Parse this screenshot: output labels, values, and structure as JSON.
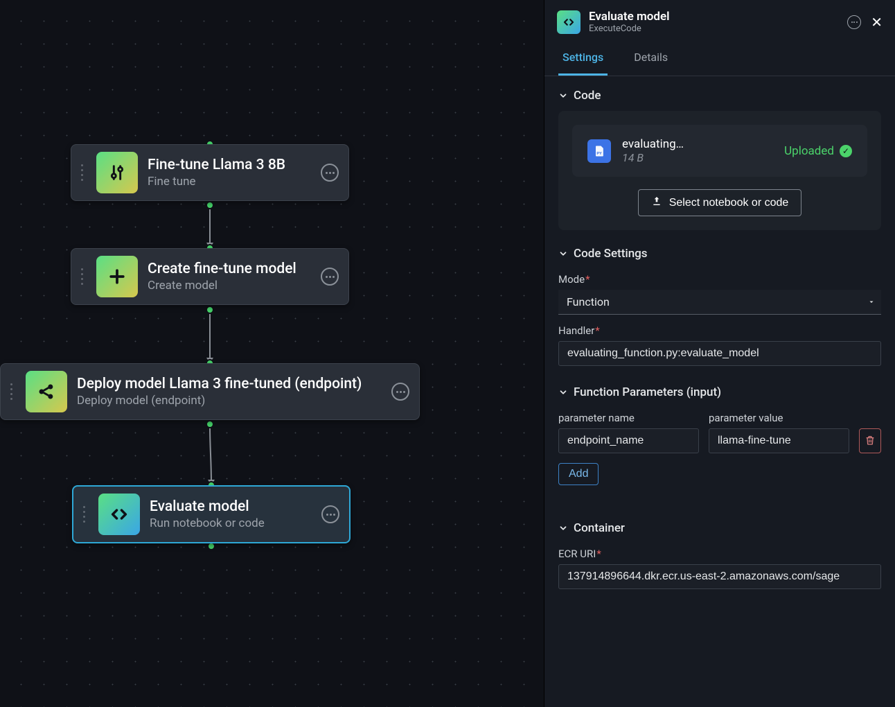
{
  "canvas": {
    "nodes": [
      {
        "title": "Fine-tune Llama 3 8B",
        "subtitle": "Fine tune"
      },
      {
        "title": "Create fine-tune model",
        "subtitle": "Create model"
      },
      {
        "title": "Deploy model Llama 3 fine-tuned (endpoint)",
        "subtitle": "Deploy model (endpoint)"
      },
      {
        "title": "Evaluate model",
        "subtitle": "Run notebook or code"
      }
    ]
  },
  "panel": {
    "header": {
      "title": "Evaluate model",
      "subtitle": "ExecuteCode"
    },
    "tabs": {
      "settings": "Settings",
      "details": "Details"
    },
    "sections": {
      "code": {
        "label": "Code",
        "file": {
          "name": "evaluating_function.py",
          "size": "14 B",
          "status": "Uploaded"
        },
        "select_button": "Select notebook or code"
      },
      "code_settings": {
        "label": "Code Settings",
        "mode_label": "Mode",
        "mode_value": "Function",
        "handler_label": "Handler",
        "handler_value": "evaluating_function.py:evaluate_model"
      },
      "function_params": {
        "label": "Function Parameters (input)",
        "name_label": "parameter name",
        "value_label": "parameter value",
        "rows": [
          {
            "name": "endpoint_name",
            "value": "llama-fine-tune"
          }
        ],
        "add_label": "Add"
      },
      "container": {
        "label": "Container",
        "uri_label": "ECR URI",
        "uri_value": "137914896644.dkr.ecr.us-east-2.amazonaws.com/sage"
      }
    }
  }
}
